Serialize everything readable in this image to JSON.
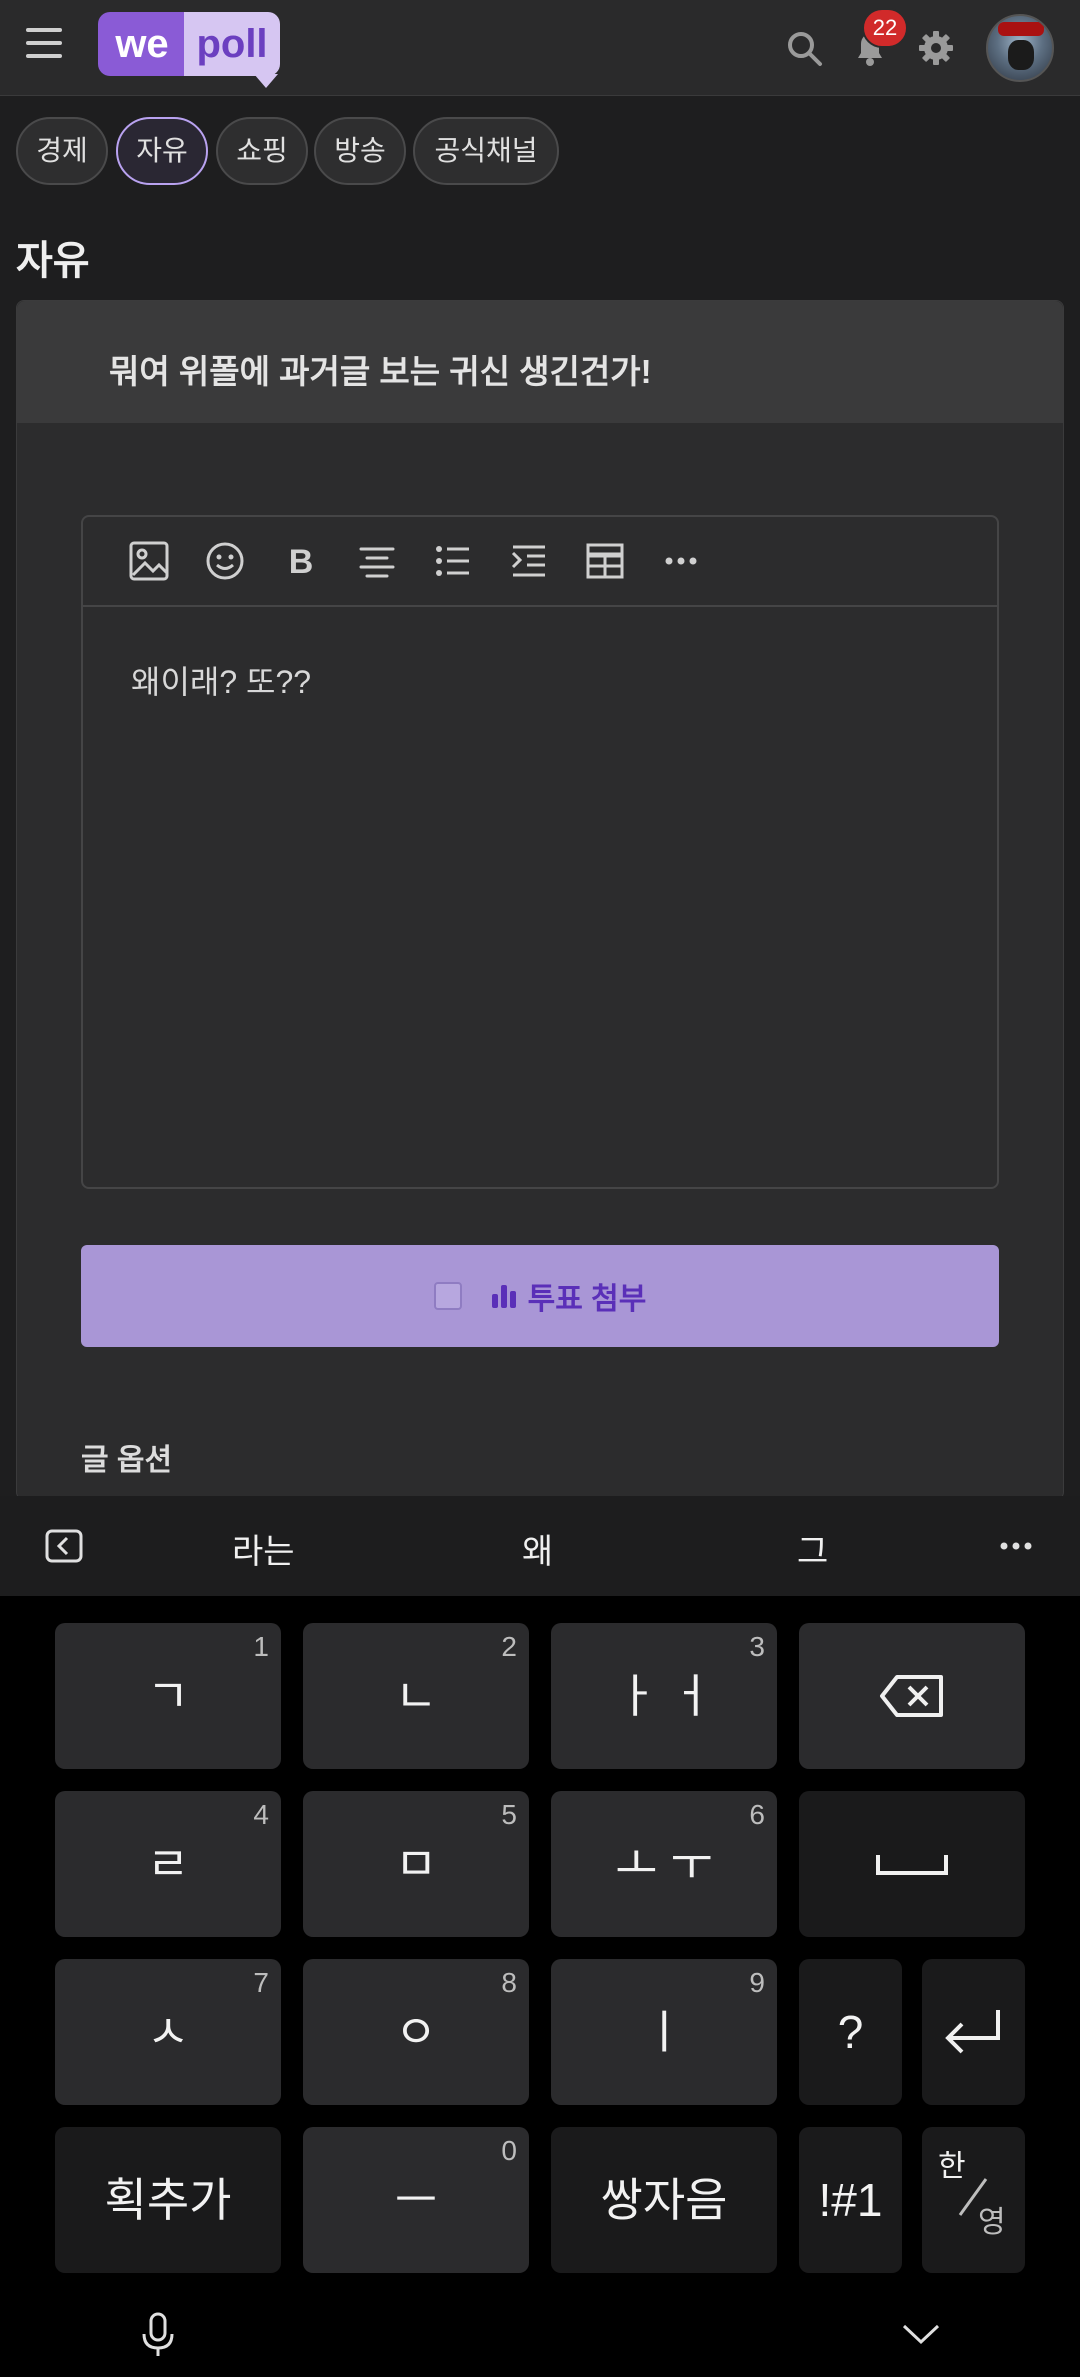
{
  "header": {
    "logo_we": "we",
    "logo_poll": "poll",
    "notification_count": "22"
  },
  "categories": [
    {
      "label": "경제",
      "active": false
    },
    {
      "label": "자유",
      "active": true
    },
    {
      "label": "쇼핑",
      "active": false
    },
    {
      "label": "방송",
      "active": false
    },
    {
      "label": "공식채널",
      "active": false
    }
  ],
  "board_title": "자유",
  "post": {
    "title": "뭐여 위폴에 과거글 보는 귀신 생긴건가!",
    "body": "왜이래? 또??"
  },
  "toolbar_icons": [
    "image-icon",
    "emoji-icon",
    "bold-icon",
    "align-center-icon",
    "bullet-list-icon",
    "indent-icon",
    "table-icon",
    "more-icon"
  ],
  "poll_button": {
    "label": "투표 첨부",
    "checked": false
  },
  "options_label": "글 옵션",
  "keyboard": {
    "suggestions": [
      "라는",
      "왜",
      "그"
    ],
    "rows": [
      [
        {
          "label": "ㄱ",
          "num": "1"
        },
        {
          "label": "ㄴ",
          "num": "2"
        },
        {
          "label": "ㅏ ㅓ",
          "num": "3"
        },
        {
          "label": "backspace",
          "num": ""
        }
      ],
      [
        {
          "label": "ㄹ",
          "num": "4"
        },
        {
          "label": "ㅁ",
          "num": "5"
        },
        {
          "label": "ㅗ ㅜ",
          "num": "6"
        },
        {
          "label": "space",
          "num": ""
        }
      ],
      [
        {
          "label": "ㅅ",
          "num": "7"
        },
        {
          "label": "ㅇ",
          "num": "8"
        },
        {
          "label": "ㅣ",
          "num": "9"
        },
        {
          "label": "?",
          "num": ""
        },
        {
          "label": "enter",
          "num": ""
        }
      ],
      [
        {
          "label": "획추가",
          "num": ""
        },
        {
          "label": "ㅡ",
          "num": "0"
        },
        {
          "label": "쌍자음",
          "num": ""
        },
        {
          "label": "!#1",
          "num": ""
        },
        {
          "label": "한/영",
          "num": ""
        }
      ]
    ],
    "lang_top": "한",
    "lang_bottom": "영"
  },
  "colors": {
    "accent": "#8a5bd6",
    "poll_bg": "#a996d6",
    "badge": "#d12a2a"
  }
}
